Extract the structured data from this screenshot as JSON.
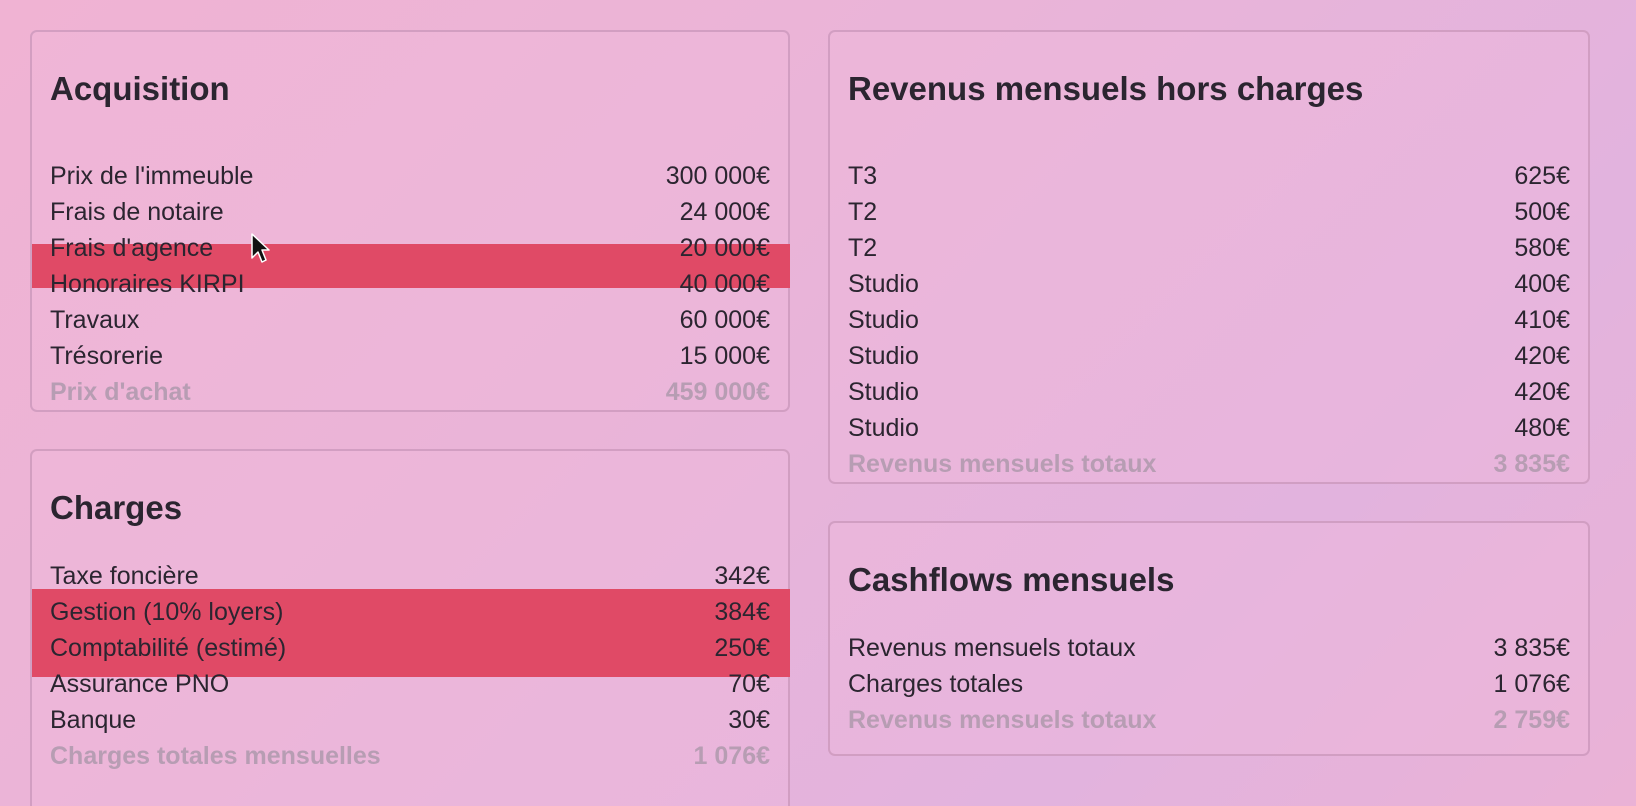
{
  "acquisition": {
    "title": "Acquisition",
    "rows": [
      {
        "label": "Prix de l'immeuble",
        "value": "300 000€"
      },
      {
        "label": "Frais de notaire",
        "value": "24 000€"
      },
      {
        "label": "Frais d'agence",
        "value": "20 000€"
      },
      {
        "label": "Honoraires KIRPI",
        "value": "40 000€"
      },
      {
        "label": "Travaux",
        "value": "60 000€"
      },
      {
        "label": "Trésorerie",
        "value": "15 000€"
      }
    ],
    "total": {
      "label": "Prix d'achat",
      "value": "459 000€"
    }
  },
  "charges": {
    "title": "Charges",
    "rows": [
      {
        "label": "Taxe foncière",
        "value": "342€"
      },
      {
        "label": "Gestion (10% loyers)",
        "value": "384€"
      },
      {
        "label": "Comptabilité (estimé)",
        "value": "250€"
      },
      {
        "label": "Assurance PNO",
        "value": "70€"
      },
      {
        "label": "Banque",
        "value": "30€"
      }
    ],
    "total": {
      "label": "Charges totales mensuelles",
      "value": "1 076€"
    }
  },
  "revenus": {
    "title": "Revenus mensuels hors charges",
    "rows": [
      {
        "label": "T3",
        "value": "625€"
      },
      {
        "label": "T2",
        "value": "500€"
      },
      {
        "label": "T2",
        "value": "580€"
      },
      {
        "label": "Studio",
        "value": "400€"
      },
      {
        "label": "Studio",
        "value": "410€"
      },
      {
        "label": "Studio",
        "value": "420€"
      },
      {
        "label": "Studio",
        "value": "420€"
      },
      {
        "label": "Studio",
        "value": "480€"
      }
    ],
    "total": {
      "label": "Revenus mensuels totaux",
      "value": "3 835€"
    }
  },
  "cashflows": {
    "title": "Cashflows mensuels",
    "rows": [
      {
        "label": "Revenus mensuels totaux",
        "value": "3 835€"
      },
      {
        "label": "Charges totales",
        "value": "1 076€"
      }
    ],
    "total": {
      "label": "Revenus mensuels totaux",
      "value": "2 759€"
    }
  },
  "colors": {
    "highlight": "#e04a66",
    "text": "#2b2530",
    "total_text": "#b79db3",
    "background": "#eab4d8"
  },
  "cursor_icon": "mouse-pointer-icon"
}
